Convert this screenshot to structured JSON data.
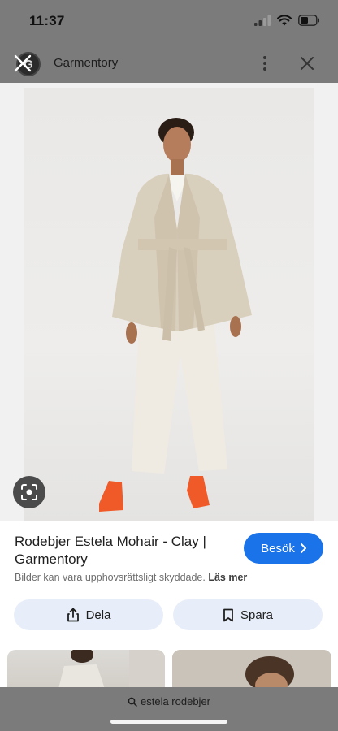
{
  "status": {
    "time": "11:37"
  },
  "header": {
    "site_initial": "G",
    "site_name": "Garmentory"
  },
  "result": {
    "title": "Rodebjer Estela Mohair - Clay | Garmentory",
    "visit_label": "Besök",
    "copyright_text": "Bilder kan vara upphovsrättsligt skyddade.",
    "learn_more": "Läs mer",
    "share_label": "Dela",
    "save_label": "Spara"
  },
  "search": {
    "query": "estela rodebjer"
  },
  "colors": {
    "accent": "#1a73e8",
    "scrim": "#7b7b7b",
    "shoes": "#ef5a28"
  }
}
